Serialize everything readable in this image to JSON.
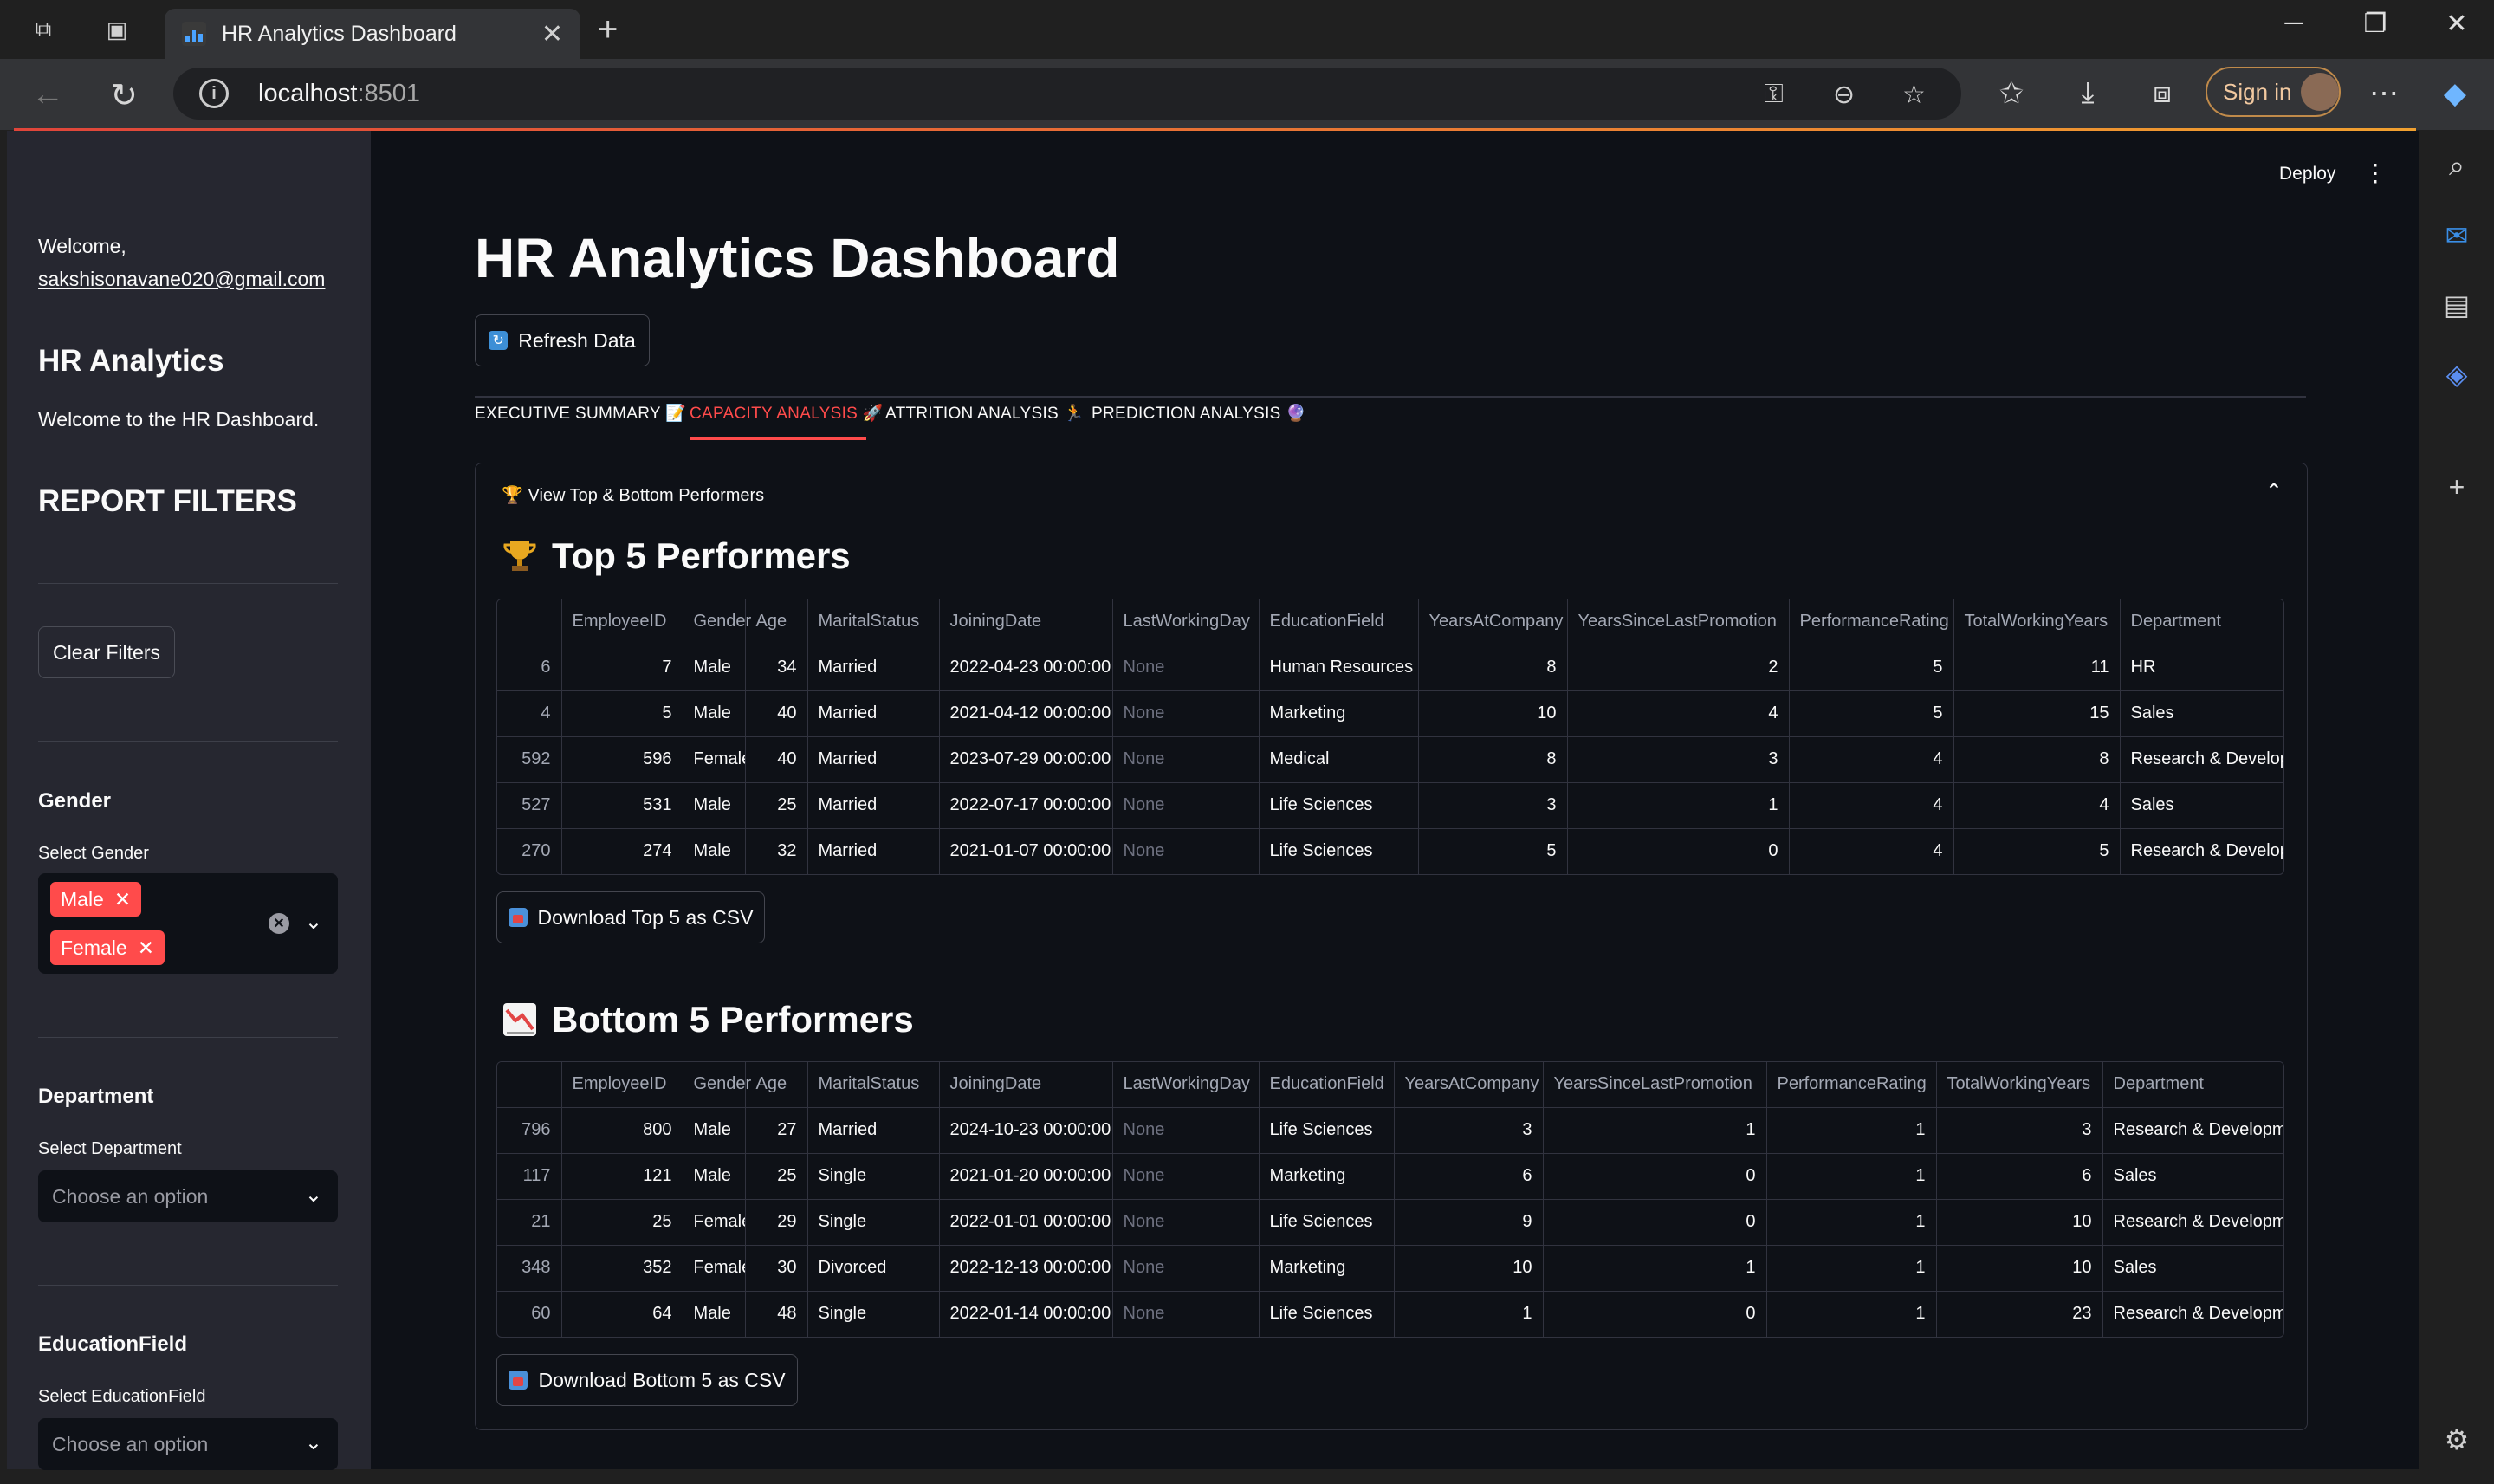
{
  "browser": {
    "tab_title": "HR Analytics Dashboard",
    "url_host": "localhost",
    "url_port": ":8501",
    "signin_label": "Sign in"
  },
  "sidebar": {
    "welcome": "Welcome,",
    "email": "sakshisonavane020@gmail.com",
    "title": "HR Analytics",
    "subtitle": "Welcome to the HR Dashboard.",
    "filters_heading": "REPORT FILTERS",
    "clear_filters": "Clear Filters",
    "gender": {
      "heading": "Gender",
      "label": "Select Gender",
      "selected": [
        "Male",
        "Female"
      ]
    },
    "department": {
      "heading": "Department",
      "label": "Select Department",
      "placeholder": "Choose an option"
    },
    "education": {
      "heading": "EducationField",
      "label": "Select EducationField",
      "placeholder": "Choose an option"
    }
  },
  "main": {
    "deploy": "Deploy",
    "title": "HR Analytics Dashboard",
    "refresh": "Refresh Data",
    "tabs": [
      {
        "label": "EXECUTIVE SUMMARY 📝"
      },
      {
        "label": "CAPACITY ANALYSIS 🚀"
      },
      {
        "label": "ATTRITION ANALYSIS 🏃"
      },
      {
        "label": "PREDICTION ANALYSIS 🔮"
      }
    ],
    "expander_title": "View Top & Bottom Performers",
    "top_heading": "Top 5 Performers",
    "bottom_heading": "Bottom 5 Performers",
    "download_top": "Download Top 5 as CSV",
    "download_bottom": "Download Bottom 5 as CSV",
    "columns": [
      "",
      "EmployeeID",
      "Gender",
      "Age",
      "MaritalStatus",
      "JoiningDate",
      "LastWorkingDay",
      "EducationField",
      "YearsAtCompany",
      "YearsSinceLastPromotion",
      "PerformanceRating",
      "TotalWorkingYears",
      "Department"
    ],
    "top_rows": [
      [
        "6",
        "7",
        "Male",
        "34",
        "Married",
        "2022-04-23 00:00:00",
        "None",
        "Human Resources",
        "8",
        "2",
        "5",
        "11",
        "HR"
      ],
      [
        "4",
        "5",
        "Male",
        "40",
        "Married",
        "2021-04-12 00:00:00",
        "None",
        "Marketing",
        "10",
        "4",
        "5",
        "15",
        "Sales"
      ],
      [
        "592",
        "596",
        "Female",
        "40",
        "Married",
        "2023-07-29 00:00:00",
        "None",
        "Medical",
        "8",
        "3",
        "4",
        "8",
        "Research & Developn"
      ],
      [
        "527",
        "531",
        "Male",
        "25",
        "Married",
        "2022-07-17 00:00:00",
        "None",
        "Life Sciences",
        "3",
        "1",
        "4",
        "4",
        "Sales"
      ],
      [
        "270",
        "274",
        "Male",
        "32",
        "Married",
        "2021-01-07 00:00:00",
        "None",
        "Life Sciences",
        "5",
        "0",
        "4",
        "5",
        "Research & Developn"
      ]
    ],
    "bottom_rows": [
      [
        "796",
        "800",
        "Male",
        "27",
        "Married",
        "2024-10-23 00:00:00",
        "None",
        "Life Sciences",
        "3",
        "1",
        "1",
        "3",
        "Research & Developmen"
      ],
      [
        "117",
        "121",
        "Male",
        "25",
        "Single",
        "2021-01-20 00:00:00",
        "None",
        "Marketing",
        "6",
        "0",
        "1",
        "6",
        "Sales"
      ],
      [
        "21",
        "25",
        "Female",
        "29",
        "Single",
        "2022-01-01 00:00:00",
        "None",
        "Life Sciences",
        "9",
        "0",
        "1",
        "10",
        "Research & Developmen"
      ],
      [
        "348",
        "352",
        "Female",
        "30",
        "Divorced",
        "2022-12-13 00:00:00",
        "None",
        "Marketing",
        "10",
        "1",
        "1",
        "10",
        "Sales"
      ],
      [
        "60",
        "64",
        "Male",
        "48",
        "Single",
        "2022-01-14 00:00:00",
        "None",
        "Life Sciences",
        "1",
        "0",
        "1",
        "23",
        "Research & Developmen"
      ]
    ]
  }
}
